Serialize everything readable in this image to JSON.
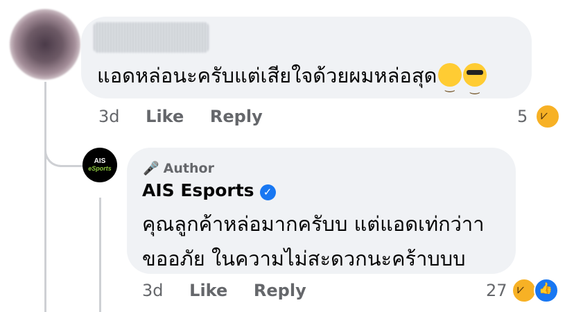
{
  "comment": {
    "text": "แอดหล่อนะครับแต่เสียใจด้วยผมหล่อสุด",
    "emojis": [
      "smirking-face-icon",
      "smiling-face-with-sunglasses-icon"
    ],
    "time": "3d",
    "like_label": "Like",
    "reply_label": "Reply",
    "reaction_count": "5",
    "reaction_icons": [
      "haha-icon"
    ]
  },
  "reply": {
    "badge": "Author",
    "author_name": "AIS Esports",
    "avatar_logo": {
      "line1": "AIS",
      "line2": "eSports"
    },
    "text_line1": "คุณลูกค้าหล่อมากครับบ แต่แอดเท่กว่าา",
    "text_line2": "ขออภัย ในความไม่สะดวกนะคร้าบบบ",
    "time": "3d",
    "like_label": "Like",
    "reply_label": "Reply",
    "reaction_count": "27",
    "reaction_icons": [
      "haha-icon",
      "like-icon"
    ]
  },
  "colors": {
    "bubble": "#f0f2f5",
    "meta": "#65676b",
    "verified": "#1877f2"
  }
}
